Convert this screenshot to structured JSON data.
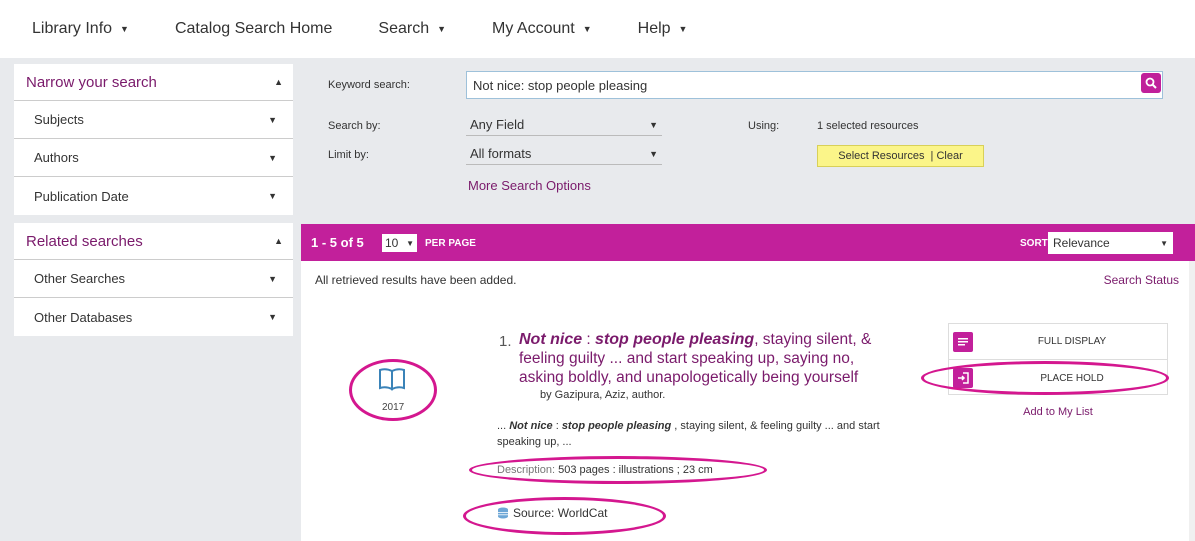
{
  "nav": {
    "items": [
      {
        "label": "Library Info",
        "has_menu": true
      },
      {
        "label": "Catalog Search Home",
        "has_menu": false
      },
      {
        "label": "Search",
        "has_menu": true
      },
      {
        "label": "My Account",
        "has_menu": true
      },
      {
        "label": "Help",
        "has_menu": true
      }
    ]
  },
  "sidebar": {
    "narrow": {
      "title": "Narrow your search",
      "items": [
        "Subjects",
        "Authors",
        "Publication Date"
      ]
    },
    "related": {
      "title": "Related searches",
      "items": [
        "Other Searches",
        "Other Databases"
      ]
    }
  },
  "search": {
    "keyword_label": "Keyword search:",
    "keyword_value": "Not nice: stop people pleasing",
    "search_by_label": "Search by:",
    "search_by_value": "Any Field",
    "limit_by_label": "Limit by:",
    "limit_by_value": "All formats",
    "using_label": "Using:",
    "using_value": "1 selected resources",
    "resources_button": "Select Resources  | Clear",
    "more_options": "More Search Options"
  },
  "results_bar": {
    "count": "1 - 5 of 5",
    "per_page_value": "10",
    "per_page_label": "PER PAGE",
    "sort_label": "SORT",
    "sort_value": "Relevance"
  },
  "results": {
    "retrieved_msg": "All retrieved results have been added.",
    "status_link": "Search Status",
    "item": {
      "number": "1.",
      "title_main": "Not nice",
      "title_sep": " : ",
      "title_sub": "stop people pleasing",
      "title_rest": ", staying silent, & feeling guilty ... and start speaking up, saying no, asking boldly, and unapologetically being yourself",
      "author": "by Gazipura, Aziz, author.",
      "snippet_prefix": "... ",
      "snippet_main": "Not nice",
      "snippet_sep": " : ",
      "snippet_sub": "stop people pleasing",
      "snippet_rest": " , staying silent, & feeling guilty ... and start speaking up, ...",
      "description_label": "Description:",
      "description_value": " 503 pages : illustrations ; 23 cm",
      "source": "Source: WorldCat",
      "year": "2017",
      "format_icon": "book-icon"
    },
    "actions": {
      "full_display": "FULL DISPLAY",
      "place_hold": "PLACE HOLD",
      "add_to_list": "Add to My List"
    }
  },
  "colors": {
    "accent": "#c2209b",
    "link": "#7a1a6b",
    "highlight": "#d4178f",
    "resource_button": "#fbf589"
  }
}
